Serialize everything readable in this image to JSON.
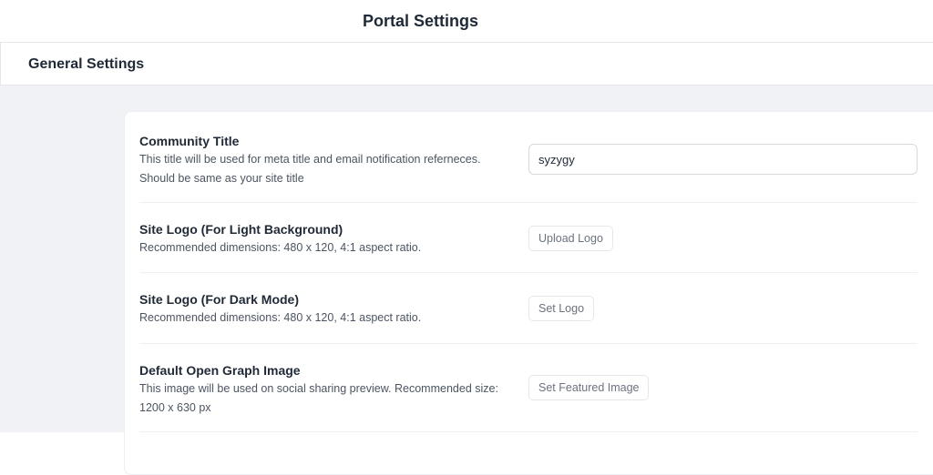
{
  "header": {
    "title": "Portal Settings"
  },
  "section": {
    "title": "General Settings"
  },
  "settings": {
    "community_title": {
      "label": "Community Title",
      "description": "This title will be used for meta title and email notification referneces. Should be same as your site title",
      "value": "syzygy"
    },
    "logo_light": {
      "label": "Site Logo (For Light Background)",
      "description": "Recommended dimensions: 480 x 120, 4:1 aspect ratio.",
      "button_label": "Upload Logo"
    },
    "logo_dark": {
      "label": "Site Logo (For Dark Mode)",
      "description": "Recommended dimensions: 480 x 120, 4:1 aspect ratio.",
      "button_label": "Set Logo"
    },
    "og_image": {
      "label": "Default Open Graph Image",
      "description": "This image will be used on social sharing preview. Recommended size: 1200 x 630 px",
      "button_label": "Set Featured Image"
    }
  }
}
